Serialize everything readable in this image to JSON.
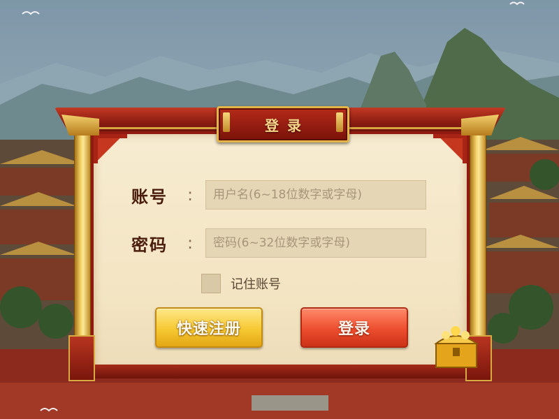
{
  "dialog": {
    "title": "登录"
  },
  "form": {
    "account": {
      "label": "账号",
      "colon": ":",
      "value": "",
      "placeholder": "用户名(6~18位数字或字母)"
    },
    "password": {
      "label": "密码",
      "colon": ":",
      "value": "",
      "placeholder": "密码(6~32位数字或字母)"
    },
    "remember": {
      "label": "记住账号",
      "checked": false
    }
  },
  "buttons": {
    "register_label": "快速注册",
    "login_label": "登录"
  },
  "icons": {
    "chest": "treasure-chest-icon",
    "checkbox": "checkbox-icon"
  },
  "colors": {
    "frame_red": "#8e1a10",
    "gold": "#e4b548",
    "parchment": "#f4e6c6",
    "register_button": "#f6c933",
    "login_button": "#ec4d2e"
  }
}
